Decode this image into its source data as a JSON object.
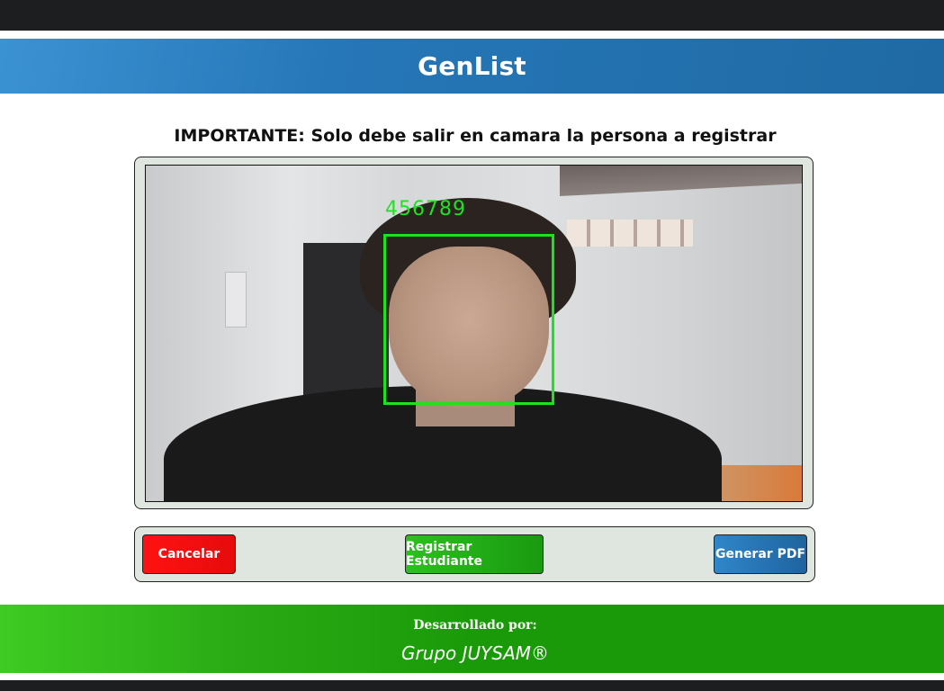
{
  "app": {
    "title": "GenList"
  },
  "notice": {
    "text": "IMPORTANTE: Solo debe salir en camara la persona a registrar"
  },
  "camera": {
    "detected_id": "456789",
    "box_color": "#19e619"
  },
  "buttons": {
    "cancel_label": "Cancelar",
    "register_label": "Registrar Estudiante",
    "pdf_label": "Generar PDF"
  },
  "footer": {
    "label": "Desarrollado por:",
    "brand": "Grupo JUYSAM®"
  },
  "colors": {
    "header": "#2677b8",
    "footer": "#1a9a08",
    "cancel": "#e60b0b",
    "register": "#1a9a10",
    "pdf": "#1f63a0",
    "panel": "#dfe5df"
  }
}
